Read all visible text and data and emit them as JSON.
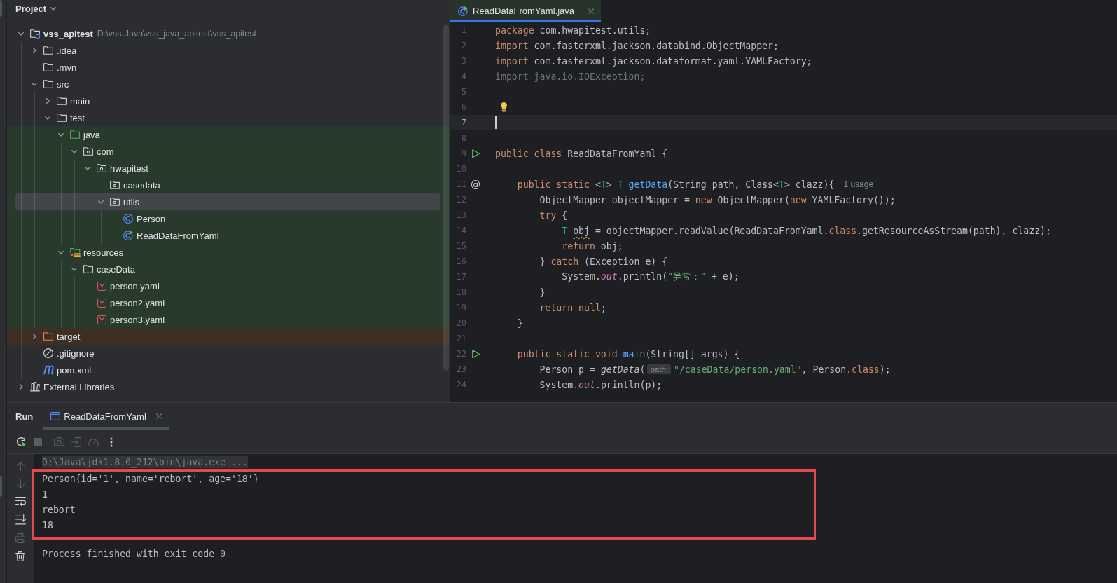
{
  "project_panel": {
    "title": "Project",
    "tree": [
      {
        "label": "vss_apitest",
        "path": "D:\\vss-Java\\vss_java_apitest\\vss_apitest",
        "kind": "module",
        "expanded": true,
        "selected": false,
        "children": [
          {
            "label": ".idea",
            "kind": "folder",
            "expanded": false,
            "selected": false
          },
          {
            "label": ".mvn",
            "kind": "folder",
            "selected": false
          },
          {
            "label": "src",
            "kind": "folder",
            "expanded": true,
            "selected": false,
            "children": [
              {
                "label": "main",
                "kind": "folder",
                "expanded": false,
                "selected": false
              },
              {
                "label": "test",
                "kind": "folder",
                "expanded": true,
                "selected": false,
                "children": [
                  {
                    "label": "java",
                    "kind": "test-root",
                    "expanded": true,
                    "selected": false,
                    "children": [
                      {
                        "label": "com",
                        "kind": "package",
                        "expanded": true,
                        "selected": false,
                        "children": [
                          {
                            "label": "hwapitest",
                            "kind": "package",
                            "expanded": true,
                            "selected": false,
                            "children": [
                              {
                                "label": "casedata",
                                "kind": "package",
                                "selected": false
                              },
                              {
                                "label": "utils",
                                "kind": "package",
                                "expanded": true,
                                "selected": true,
                                "children": [
                                  {
                                    "label": "Person",
                                    "kind": "class",
                                    "selected": false
                                  },
                                  {
                                    "label": "ReadDataFromYaml",
                                    "kind": "runnable-class",
                                    "selected": false
                                  }
                                ]
                              }
                            ]
                          }
                        ]
                      }
                    ]
                  },
                  {
                    "label": "resources",
                    "kind": "test-resources-root",
                    "expanded": true,
                    "selected": false,
                    "children": [
                      {
                        "label": "caseData",
                        "kind": "folder",
                        "expanded": true,
                        "selected": false,
                        "children": [
                          {
                            "label": "person.yaml",
                            "kind": "yaml",
                            "selected": false
                          },
                          {
                            "label": "person2.yaml",
                            "kind": "yaml",
                            "selected": false
                          },
                          {
                            "label": "person3.yaml",
                            "kind": "yaml",
                            "selected": false
                          }
                        ]
                      }
                    ]
                  }
                ]
              }
            ]
          },
          {
            "label": "target",
            "kind": "excluded",
            "expanded": false,
            "selected": false
          },
          {
            "label": ".gitignore",
            "kind": "ignore",
            "selected": false
          },
          {
            "label": "pom.xml",
            "kind": "maven",
            "selected": false
          }
        ]
      },
      {
        "label": "External Libraries",
        "kind": "libraries",
        "expanded": false,
        "selected": false
      }
    ]
  },
  "editor": {
    "tabs": [
      {
        "label": "ReadDataFromYaml.java",
        "kind": "runnable-class",
        "selected": true
      }
    ],
    "lines": [
      {
        "number": "1",
        "current": false,
        "tokens": [
          {
            "text": "package",
            "kind": "keyword"
          },
          {
            "text": " com.hwapitest.utils;",
            "kind": "plain"
          }
        ]
      },
      {
        "number": "2",
        "current": false,
        "tokens": [
          {
            "text": "import",
            "kind": "keyword"
          },
          {
            "text": " com.fasterxml.jackson.databind.ObjectMapper;",
            "kind": "plain"
          }
        ]
      },
      {
        "number": "3",
        "current": false,
        "tokens": [
          {
            "text": "import",
            "kind": "keyword"
          },
          {
            "text": " com.fasterxml.jackson.dataformat.yaml.YAMLFactory;",
            "kind": "plain"
          }
        ]
      },
      {
        "number": "4",
        "current": false,
        "tokens": [
          {
            "text": "import java.io.IOException;",
            "kind": "unused"
          }
        ]
      },
      {
        "number": "5",
        "current": false
      },
      {
        "number": "6",
        "current": false,
        "intention": true
      },
      {
        "number": "7",
        "current": true
      },
      {
        "number": "8",
        "current": false
      },
      {
        "number": "9",
        "current": false,
        "runnable": true,
        "tokens": [
          {
            "text": "public class",
            "kind": "keyword"
          },
          {
            "text": " ReadDataFromYaml {",
            "kind": "plain"
          }
        ]
      },
      {
        "number": "10",
        "current": false
      },
      {
        "number": "11",
        "current": false,
        "gutter_text": "@",
        "tokens": [
          {
            "text": "    public static",
            "kind": "keyword"
          },
          {
            "text": " <",
            "kind": "plain"
          },
          {
            "text": "T",
            "kind": "type-param"
          },
          {
            "text": "> ",
            "kind": "plain"
          },
          {
            "text": "T",
            "kind": "type-param"
          },
          {
            "text": " getData",
            "kind": "declaration"
          },
          {
            "text": "(String path, Class<",
            "kind": "plain"
          },
          {
            "text": "T",
            "kind": "type-param"
          },
          {
            "text": "> clazz){",
            "kind": "plain"
          },
          {
            "text": "1 usage",
            "kind": "usage-hint"
          }
        ]
      },
      {
        "number": "12",
        "current": false,
        "tokens": [
          {
            "text": "        ObjectMapper objectMapper = ",
            "kind": "plain"
          },
          {
            "text": "new",
            "kind": "keyword"
          },
          {
            "text": " ObjectMapper(",
            "kind": "plain"
          },
          {
            "text": "new",
            "kind": "keyword"
          },
          {
            "text": " YAMLFactory());",
            "kind": "plain"
          }
        ]
      },
      {
        "number": "13",
        "current": false,
        "tokens": [
          {
            "text": "        try",
            "kind": "keyword"
          },
          {
            "text": " {",
            "kind": "plain"
          }
        ]
      },
      {
        "number": "14",
        "current": false,
        "tokens": [
          {
            "text": "            T ",
            "kind": "type-param"
          },
          {
            "text": "obj",
            "kind": "warning"
          },
          {
            "text": " = objectMapper.readValue(ReadDataFromYaml.",
            "kind": "plain"
          },
          {
            "text": "class",
            "kind": "keyword"
          },
          {
            "text": ".getResourceAsStream(path), clazz);",
            "kind": "plain"
          }
        ]
      },
      {
        "number": "15",
        "current": false,
        "tokens": [
          {
            "text": "            return",
            "kind": "keyword"
          },
          {
            "text": " obj;",
            "kind": "plain"
          }
        ]
      },
      {
        "number": "16",
        "current": false,
        "tokens": [
          {
            "text": "        } ",
            "kind": "plain"
          },
          {
            "text": "catch",
            "kind": "keyword"
          },
          {
            "text": " (Exception e) {",
            "kind": "plain"
          }
        ]
      },
      {
        "number": "17",
        "current": false,
        "tokens": [
          {
            "text": "            System.",
            "kind": "plain"
          },
          {
            "text": "out",
            "kind": "static-field"
          },
          {
            "text": ".println(",
            "kind": "plain"
          },
          {
            "text": "\"异常：\"",
            "kind": "string"
          },
          {
            "text": " + e);",
            "kind": "plain"
          }
        ]
      },
      {
        "number": "18",
        "current": false,
        "tokens": [
          {
            "text": "        }",
            "kind": "plain"
          }
        ]
      },
      {
        "number": "19",
        "current": false,
        "tokens": [
          {
            "text": "        return null",
            "kind": "keyword"
          },
          {
            "text": ";",
            "kind": "plain"
          }
        ]
      },
      {
        "number": "20",
        "current": false,
        "tokens": [
          {
            "text": "    }",
            "kind": "plain"
          }
        ]
      },
      {
        "number": "21",
        "current": false
      },
      {
        "number": "22",
        "current": false,
        "runnable": true,
        "tokens": [
          {
            "text": "    public static void",
            "kind": "keyword"
          },
          {
            "text": " main",
            "kind": "declaration"
          },
          {
            "text": "(String[] args) {",
            "kind": "plain"
          }
        ]
      },
      {
        "number": "23",
        "current": false,
        "tokens": [
          {
            "text": "        Person p = ",
            "kind": "plain"
          },
          {
            "text": "getData",
            "kind": "static-call"
          },
          {
            "text": "(",
            "kind": "plain"
          },
          {
            "text": "path:",
            "kind": "param-hint"
          },
          {
            "text": "\"/caseData/person.yaml\"",
            "kind": "string"
          },
          {
            "text": ", Person.",
            "kind": "plain"
          },
          {
            "text": "class",
            "kind": "keyword"
          },
          {
            "text": ");",
            "kind": "plain"
          }
        ]
      },
      {
        "number": "24",
        "current": false,
        "tokens": [
          {
            "text": "        System.",
            "kind": "plain"
          },
          {
            "text": "out",
            "kind": "static-field"
          },
          {
            "text": ".println(p);",
            "kind": "plain"
          }
        ]
      }
    ]
  },
  "run_panel": {
    "title": "Run",
    "tabs": [
      {
        "label": "ReadDataFromYaml",
        "selected": true
      }
    ],
    "toolbar": [
      {
        "disabled": false
      },
      {
        "disabled": true
      },
      {
        "disabled": true
      },
      {
        "disabled": true
      },
      {
        "disabled": true
      },
      {
        "disabled": false
      }
    ],
    "side_toolbar": [
      {
        "disabled": true
      },
      {
        "disabled": true
      },
      {
        "disabled": false
      },
      {
        "disabled": false
      },
      {
        "disabled": true
      },
      {
        "disabled": false
      }
    ],
    "console": {
      "command": "D:\\Java\\jdk1.8.0_212\\bin\\java.exe ...",
      "highlight_output": true,
      "output": [
        "Person{id='1', name='rebort', age='18'}",
        "1",
        "rebort",
        "18"
      ],
      "status": "Process finished with exit code 0"
    }
  }
}
